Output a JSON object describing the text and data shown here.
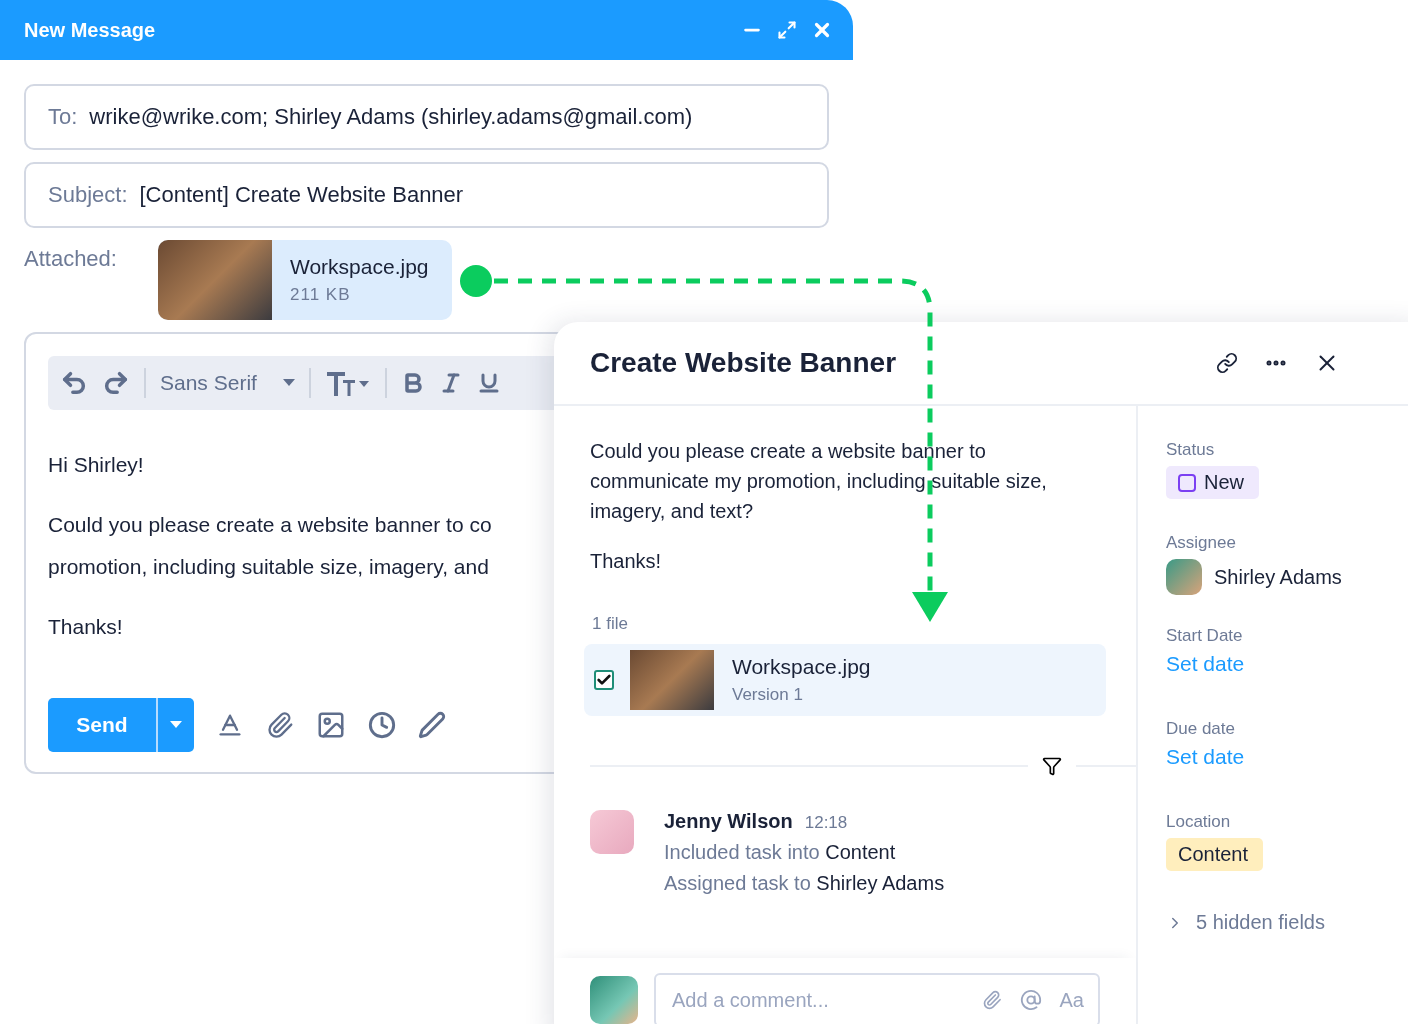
{
  "compose": {
    "title": "New Message",
    "to": {
      "label": "To:",
      "value": "wrike@wrike.com; Shirley Adams (shirley.adams@gmail.com)"
    },
    "subject": {
      "label": "Subject:",
      "value": "[Content] Create Website Banner"
    },
    "attachment": {
      "label": "Attached:",
      "name": "Workspace.jpg",
      "size": "211 KB"
    },
    "toolbar": {
      "font": "Sans Serif"
    },
    "body": [
      "Hi Shirley!",
      "Could you please create a website banner to co",
      "promotion, including suitable size, imagery, and",
      "Thanks!"
    ],
    "send": "Send"
  },
  "task": {
    "title": "Create Website Banner",
    "description": [
      "Could you please create a website banner to communicate my promotion, including suitable size, imagery, and text?",
      "Thanks!"
    ],
    "files_count": "1 file",
    "file": {
      "name": "Workspace.jpg",
      "version": "Version 1",
      "checked": true
    },
    "activity": [
      {
        "author": "Jenny Wilson",
        "time": "12:18",
        "lines": [
          {
            "action": "Included task into",
            "target": "Content"
          },
          {
            "action": "Assigned task to",
            "target": "Shirley Adams"
          }
        ]
      }
    ],
    "comment": {
      "placeholder": "Add a comment...",
      "format": "Aa"
    },
    "fields": [
      {
        "kind": "status",
        "label": "Status",
        "value": "New"
      },
      {
        "kind": "person",
        "label": "Assignee",
        "value": "Shirley Adams"
      },
      {
        "kind": "link",
        "label": "Start Date",
        "value": "Set date"
      },
      {
        "kind": "link",
        "label": "Due date",
        "value": "Set date"
      },
      {
        "kind": "tag",
        "label": "Location",
        "value": "Content"
      }
    ],
    "hidden_fields": "5 hidden fields"
  }
}
